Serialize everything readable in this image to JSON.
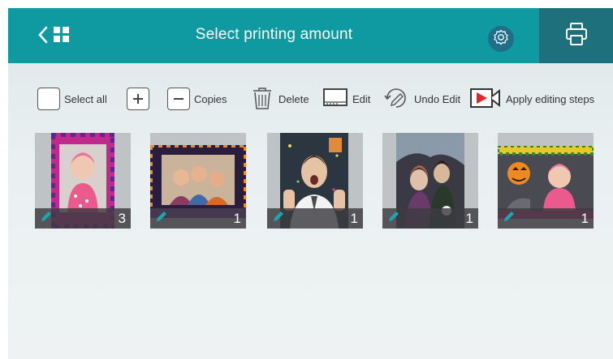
{
  "header": {
    "title": "Select printing amount"
  },
  "toolbar": {
    "select_all": "Select all",
    "copies": "Copies",
    "delete": "Delete",
    "edit": "Edit",
    "undo_edit": "Undo Edit",
    "apply_steps": "Apply editing steps"
  },
  "photos": [
    {
      "count": "3",
      "subject": "baby-frame"
    },
    {
      "count": "1",
      "subject": "kids-frame"
    },
    {
      "count": "1",
      "subject": "man-scared"
    },
    {
      "count": "1",
      "subject": "kids-spooky"
    },
    {
      "count": "1",
      "subject": "baby-pumpkin"
    }
  ],
  "colors": {
    "header": "#0f9aa2",
    "print_bg": "#1d707c",
    "settings_bg": "#1f6f8b",
    "pencil": "#19a6b5",
    "play_red": "#e3242b"
  }
}
